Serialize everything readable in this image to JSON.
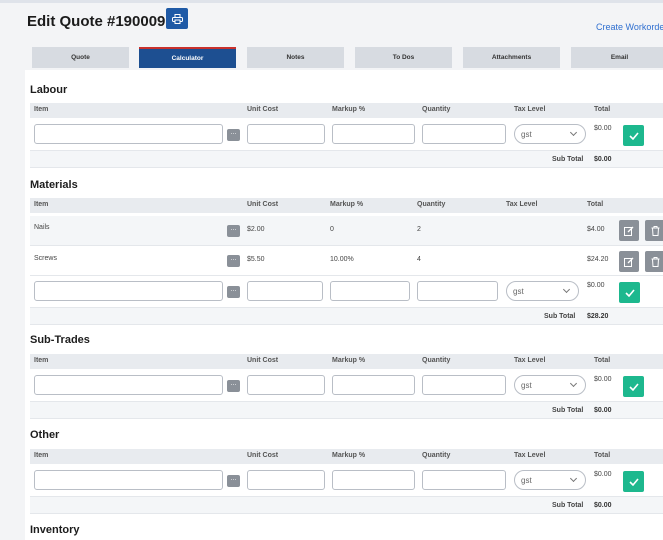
{
  "page": {
    "title": "Edit Quote #190009",
    "create_link": "Create Workorder"
  },
  "tabs": [
    "Quote",
    "Calculator",
    "Notes",
    "To Dos",
    "Attachments",
    "Email"
  ],
  "columns": [
    "Item",
    "Unit Cost",
    "Markup %",
    "Quantity",
    "Tax Level",
    "Total"
  ],
  "new_row": {
    "tax": "gst",
    "total": "$0.00",
    "dots": "..."
  },
  "sections": [
    {
      "name": "Labour",
      "subtotal_label": "Sub Total",
      "subtotal": "$0.00"
    },
    {
      "name": "Materials",
      "subtotal_label": "Sub Total",
      "subtotal": "$28.20",
      "items": [
        {
          "item": "Nails",
          "unit_cost": "$2.00",
          "markup": "0",
          "quantity": "2",
          "total": "$4.00"
        },
        {
          "item": "Screws",
          "unit_cost": "$5.50",
          "markup": "10.00%",
          "quantity": "4",
          "total": "$24.20"
        }
      ]
    },
    {
      "name": "Sub-Trades",
      "subtotal_label": "Sub Total",
      "subtotal": "$0.00"
    },
    {
      "name": "Other",
      "subtotal_label": "Sub Total",
      "subtotal": "$0.00"
    },
    {
      "name": "Inventory"
    }
  ],
  "colors": {
    "primary": "#1d4f91",
    "accent": "#1db88e",
    "active_tab_border": "#c9302c"
  }
}
